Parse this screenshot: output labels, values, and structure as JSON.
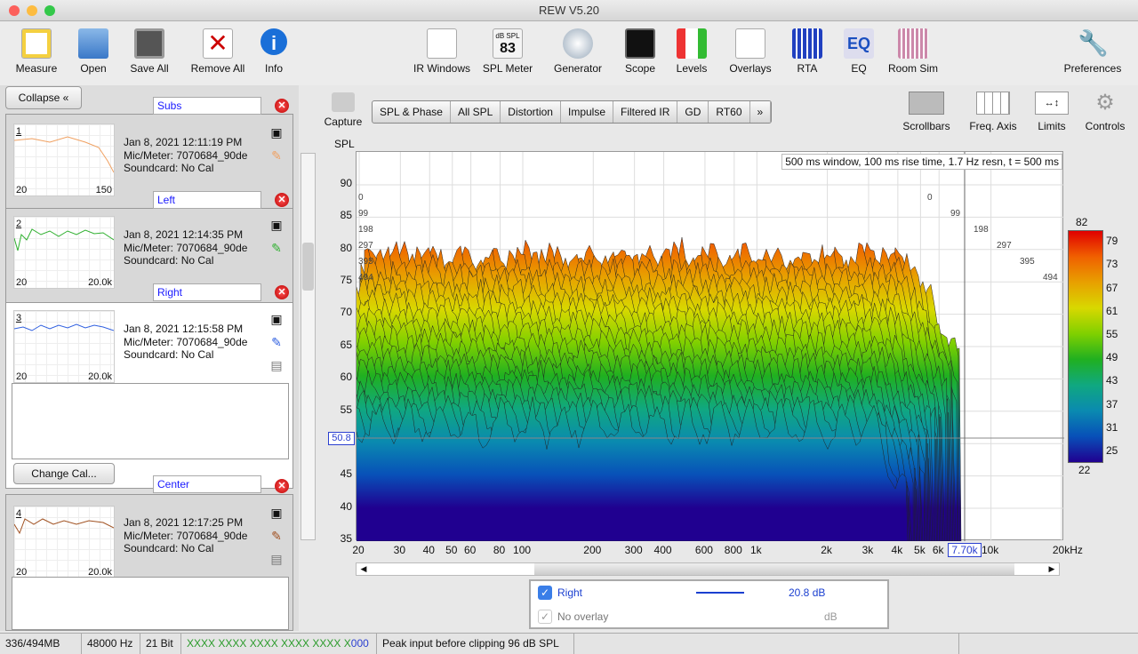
{
  "window": {
    "title": "REW V5.20"
  },
  "toolbar": {
    "left": [
      {
        "label": "Measure",
        "icon": "measure-icon"
      },
      {
        "label": "Open",
        "icon": "folder-icon"
      },
      {
        "label": "Save All",
        "icon": "save-all-icon"
      },
      {
        "label": "Remove All",
        "icon": "remove-all-icon"
      },
      {
        "label": "Info",
        "icon": "info-icon"
      }
    ],
    "center": [
      {
        "label": "IR Windows",
        "icon": "ir-windows-icon"
      },
      {
        "label": "SPL Meter",
        "icon": "spl-meter-icon",
        "badge_top": "dB SPL",
        "badge_val": "83"
      },
      {
        "label": "Generator",
        "icon": "generator-icon"
      },
      {
        "label": "Scope",
        "icon": "scope-icon"
      },
      {
        "label": "Levels",
        "icon": "levels-icon"
      },
      {
        "label": "Overlays",
        "icon": "overlays-icon"
      },
      {
        "label": "RTA",
        "icon": "rta-icon"
      },
      {
        "label": "EQ",
        "icon": "eq-icon"
      },
      {
        "label": "Room Sim",
        "icon": "room-sim-icon"
      }
    ],
    "preferences": "Preferences"
  },
  "left_panel": {
    "collapse": "Collapse",
    "change_cal": "Change Cal...",
    "measurements": [
      {
        "num": "1",
        "name": "Subs",
        "date": "Jan 8, 2021 12:11:19 PM",
        "mic": "Mic/Meter: 7070684_90de",
        "soundcard": "Soundcard: No Cal",
        "xmin": "20",
        "xmax": "150",
        "color": "#f0a060"
      },
      {
        "num": "2",
        "name": "Left",
        "date": "Jan 8, 2021 12:14:35 PM",
        "mic": "Mic/Meter: 7070684_90de",
        "soundcard": "Soundcard: No Cal",
        "xmin": "20",
        "xmax": "20.0k",
        "color": "#30b030"
      },
      {
        "num": "3",
        "name": "Right",
        "date": "Jan 8, 2021 12:15:58 PM",
        "mic": "Mic/Meter: 7070684_90de",
        "soundcard": "Soundcard: No Cal",
        "xmin": "20",
        "xmax": "20.0k",
        "color": "#3060e0"
      },
      {
        "num": "4",
        "name": "Center",
        "date": "Jan 8, 2021 12:17:25 PM",
        "mic": "Mic/Meter: 7070684_90de",
        "soundcard": "Soundcard: No Cal",
        "xmin": "20",
        "xmax": "20.0k",
        "color": "#a05020"
      }
    ]
  },
  "graph": {
    "capture": "Capture",
    "tabs": [
      "SPL & Phase",
      "All SPL",
      "Distortion",
      "Impulse",
      "Filtered IR",
      "GD",
      "RT60",
      "»"
    ],
    "right_tools": [
      "Scrollbars",
      "Freq. Axis",
      "Limits",
      "Controls"
    ],
    "info_box": "500 ms window, 100 ms rise time,  1.7 Hz resn, t = 500 ms",
    "cursor_spl": "50.8",
    "cursor_freq": "7.70k"
  },
  "chart_data": {
    "type": "waterfall",
    "ylabel": "SPL",
    "ylim": [
      35,
      90
    ],
    "yticks": [
      "90",
      "85",
      "80",
      "75",
      "70",
      "65",
      "60",
      "55",
      "50",
      "45",
      "40",
      "35"
    ],
    "xscale": "log",
    "xlim": [
      20,
      20000
    ],
    "xticks": [
      {
        "v": 20,
        "t": "20"
      },
      {
        "v": 30,
        "t": "30"
      },
      {
        "v": 40,
        "t": "40"
      },
      {
        "v": 50,
        "t": "50"
      },
      {
        "v": 60,
        "t": "60"
      },
      {
        "v": 80,
        "t": "80"
      },
      {
        "v": 100,
        "t": "100"
      },
      {
        "v": 200,
        "t": "200"
      },
      {
        "v": 300,
        "t": "300"
      },
      {
        "v": 400,
        "t": "400"
      },
      {
        "v": 600,
        "t": "600"
      },
      {
        "v": 800,
        "t": "800"
      },
      {
        "v": 1000,
        "t": "1k"
      },
      {
        "v": 2000,
        "t": "2k"
      },
      {
        "v": 3000,
        "t": "3k"
      },
      {
        "v": 4000,
        "t": "4k"
      },
      {
        "v": 5000,
        "t": "5k"
      },
      {
        "v": 6000,
        "t": "6k"
      },
      {
        "v": 10000,
        "t": "10k"
      },
      {
        "v": 20000,
        "t": "20kHz"
      }
    ],
    "time_ticks_ms": [
      "0",
      "99",
      "198",
      "297",
      "395",
      "494"
    ],
    "color_scale": {
      "max": "82",
      "min": "22",
      "ticks": [
        "79",
        "73",
        "67",
        "61",
        "55",
        "49",
        "43",
        "37",
        "31",
        "25"
      ]
    }
  },
  "legend": [
    {
      "name": "Right",
      "value": "20.8 dB",
      "checked": true,
      "color": "#1a3fd0"
    },
    {
      "name": "No overlay",
      "value": "dB",
      "checked": true
    }
  ],
  "status": [
    "336/494MB",
    "48000 Hz",
    "21 Bit",
    "XXXX XXXX  XXXX XXXX  XXXX X",
    "000",
    "Peak input before clipping 96 dB SPL"
  ]
}
